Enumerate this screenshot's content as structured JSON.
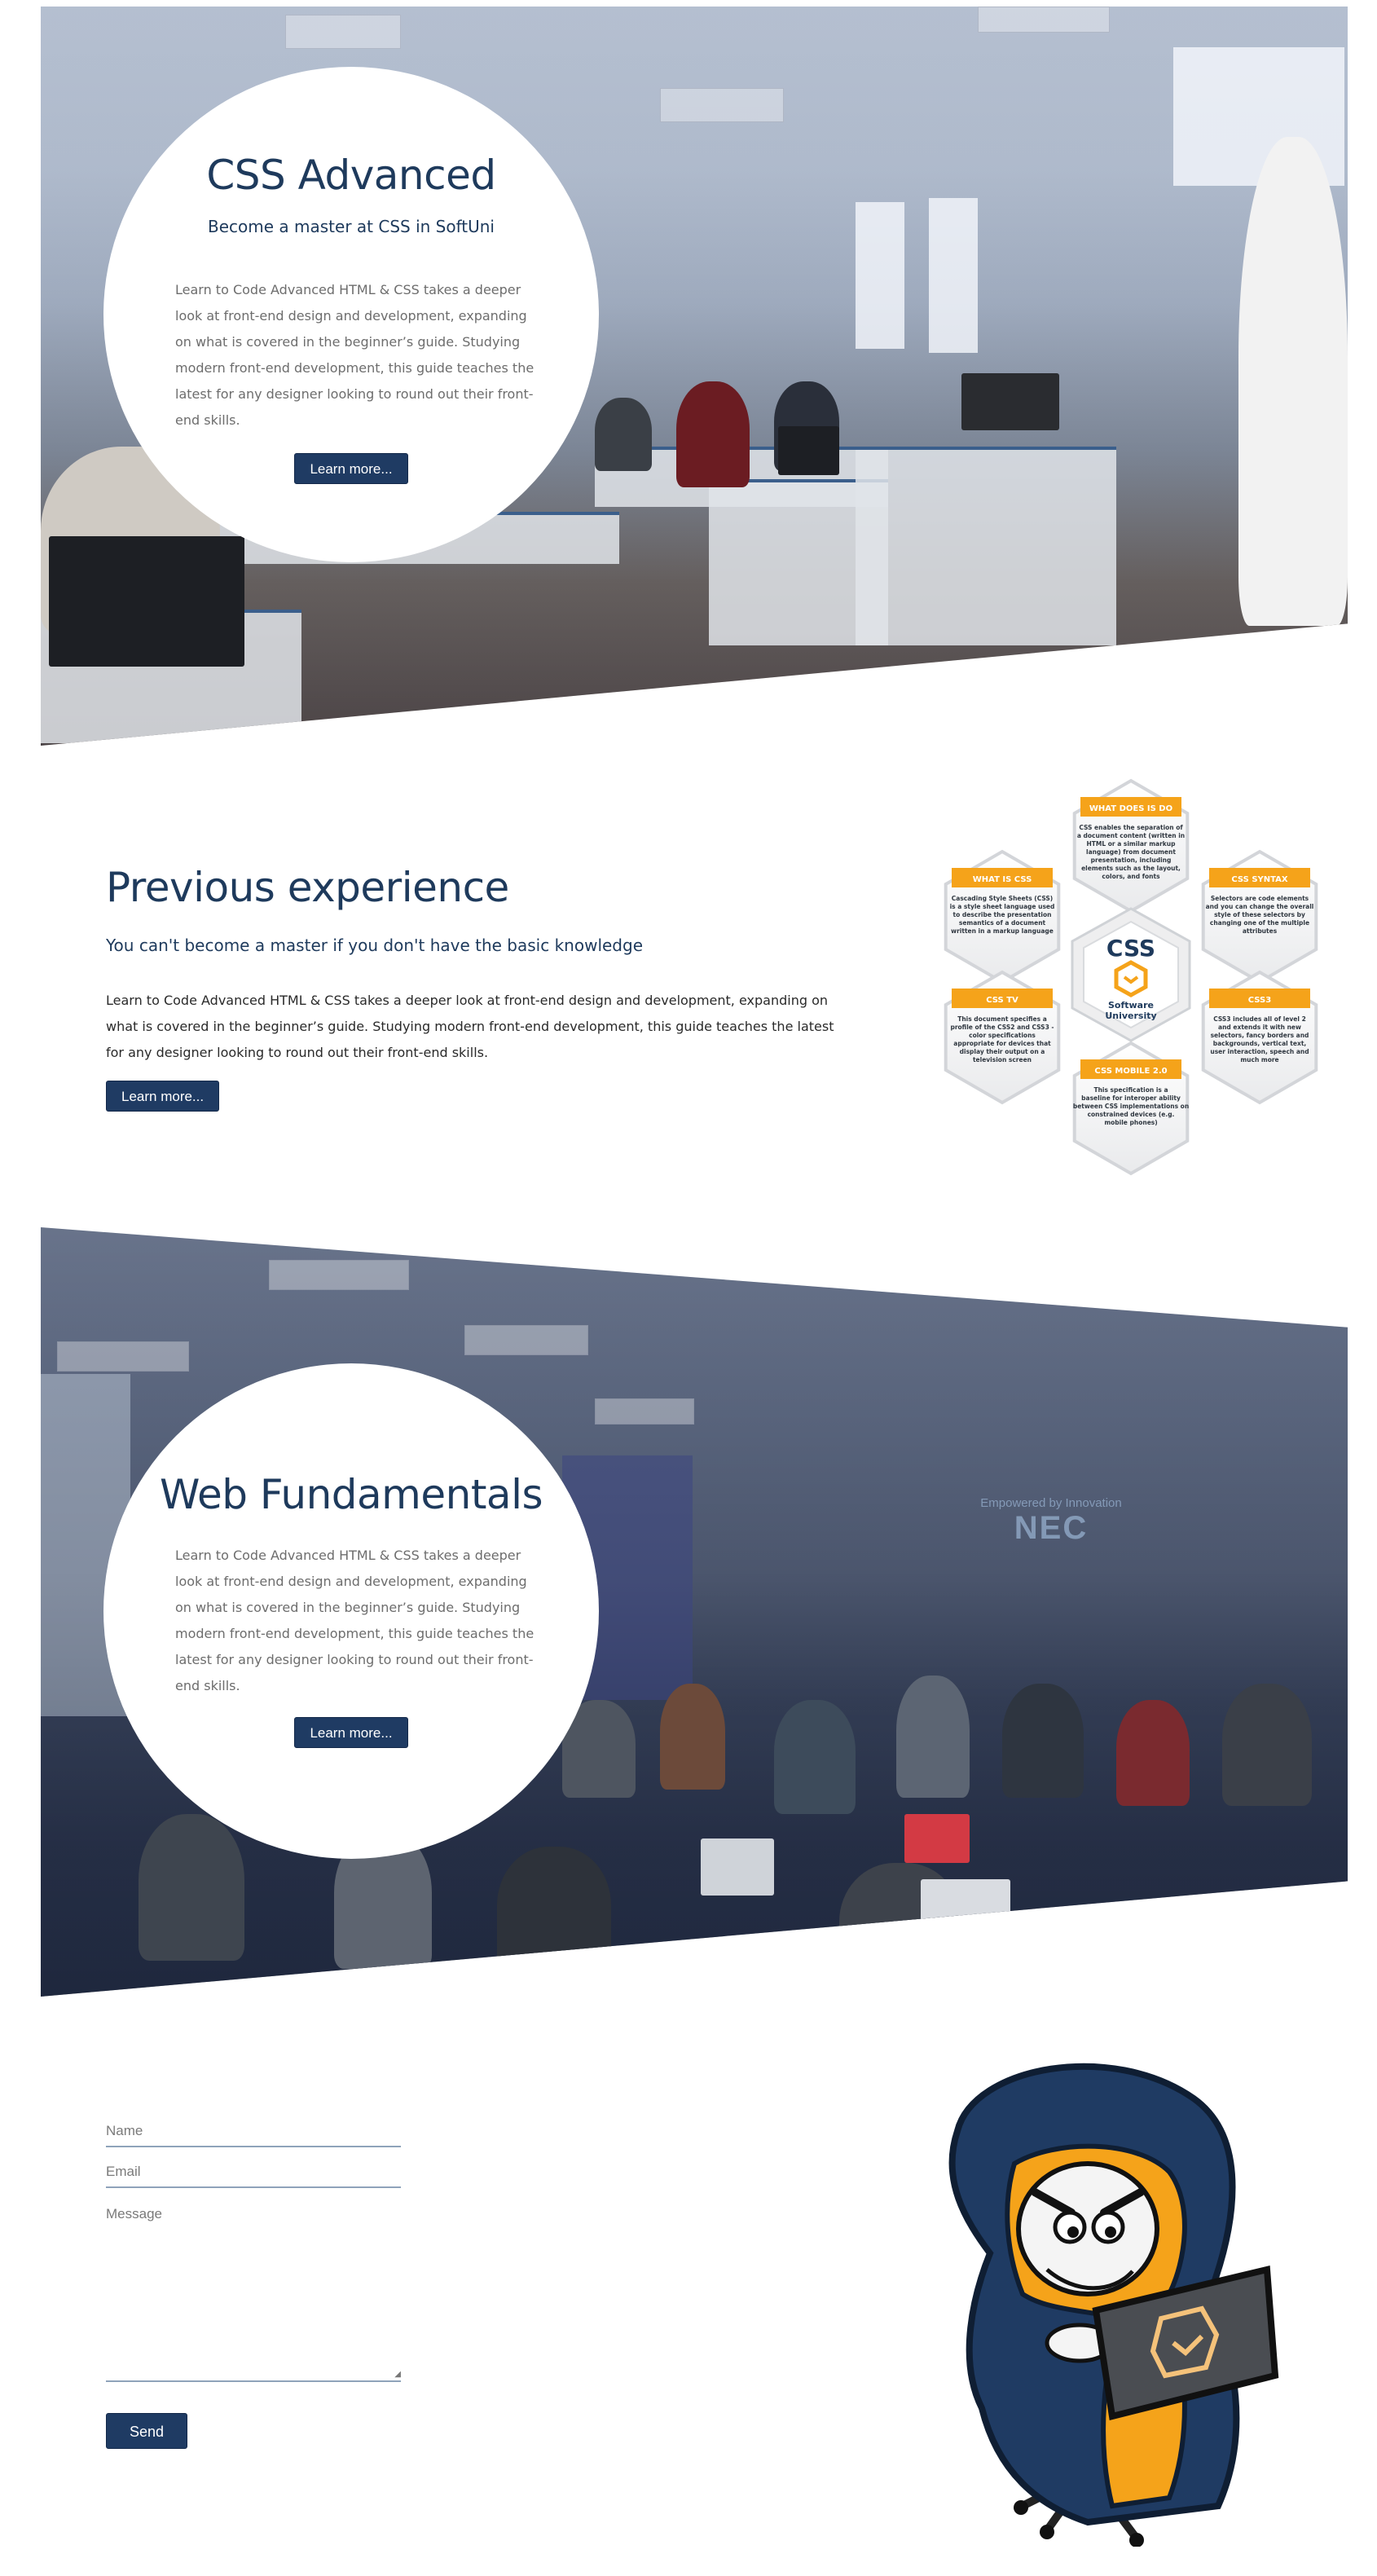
{
  "hero_advanced": {
    "title": "CSS Advanced",
    "subtitle": "Become a master at CSS in SoftUni",
    "body": "Learn to Code Advanced HTML & CSS takes a deeper look at front-end design and development, expanding on what is covered in the beginner’s guide. Studying modern front-end development, this guide teaches the latest for any designer looking to round out their front-end skills.",
    "button": "Learn more..."
  },
  "previous_experience": {
    "title": "Previous experience",
    "subtitle": "You can't become a master if you don't have the basic knowledge",
    "body": "Learn to Code Advanced HTML & CSS takes a deeper look at front-end design and development, expanding on what is covered in the beginner’s guide. Studying modern front-end development, this guide teaches the latest for any designer looking to round out their front-end skills.",
    "button": "Learn more..."
  },
  "css_infographic": {
    "center_title": "CSS",
    "center_org_line1": "Software",
    "center_org_line2": "University",
    "cells": [
      {
        "title": "WHAT DOES IS DO",
        "text": "CSS enables the separation of a document content (written in HTML or a similar markup language) from document presentation, including elements such as the layout, colors, and fonts"
      },
      {
        "title": "WHAT IS CSS",
        "text": "Cascading Style Sheets (CSS) is a style sheet language used to describe the presentation semantics of a document written in a markup language"
      },
      {
        "title": "CSS SYNTAX",
        "text": "Selectors are code elements and you can change the overall style of these selectors by changing one of the multiple attributes"
      },
      {
        "title": "CSS TV",
        "text": "This document specifies a profile of the CSS2 and CSS3 - color specifications appropriate for devices that display their output on a television screen"
      },
      {
        "title": "CSS3",
        "text": "CSS3 includes all of level 2 and extends it with new selectors, fancy borders and backgrounds, vertical text, user interaction, speech and much more"
      },
      {
        "title": "CSS MOBILE 2.0",
        "text": "This specification is a baseline for interoper ability between CSS implementations on constrained devices (e.g. mobile phones)"
      }
    ],
    "accent_color": "#f5a31a"
  },
  "hero_web": {
    "title": "Web Fundamentals",
    "body": "Learn to Code Advanced HTML & CSS takes a deeper look at front-end design and development, expanding on what is covered in the beginner’s guide. Studying modern front-end development, this guide teaches the latest for any designer looking to round out their front-end skills.",
    "button": "Learn more...",
    "projection_text": "Empowered by Innovation",
    "projection_logo": "NEC"
  },
  "contact_form": {
    "name_placeholder": "Name",
    "email_placeholder": "Email",
    "message_placeholder": "Message",
    "send_button": "Send"
  },
  "colors": {
    "primary": "#1f3b63",
    "heading": "#1e3a5c",
    "accent": "#f5a31a"
  }
}
